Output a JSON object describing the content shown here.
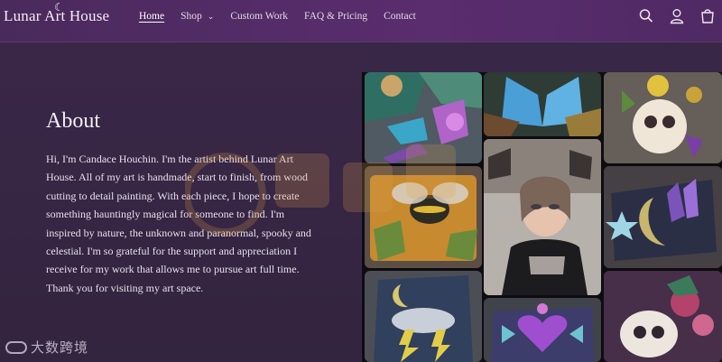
{
  "header": {
    "logo_text": "Lunar Art House",
    "nav": [
      {
        "label": "Home",
        "active": true
      },
      {
        "label": "Shop",
        "has_dropdown": true
      },
      {
        "label": "Custom Work"
      },
      {
        "label": "FAQ & Pricing"
      },
      {
        "label": "Contact"
      }
    ],
    "icons": [
      "search-icon",
      "account-icon",
      "cart-icon"
    ]
  },
  "about": {
    "title": "About",
    "body": "Hi, I'm Candace Houchin. I'm the artist behind Lunar Art House. All of my art is handmade, start to finish, from wood cutting to detail painting. With each piece, I hope to create something hauntingly magical for someone to find. I'm inspired by nature, the unknown and paranormal, spooky and celestial. I'm so grateful for the support and appreciation I receive for my work that allows me to pursue art full time. Thank you for visiting my art space."
  },
  "watermark": {
    "text": "大数跨境"
  },
  "colors": {
    "header_bg": "#55306a",
    "page_bg": "#382746",
    "text": "#e9dfe9",
    "gallery_bg": "#0e0c10"
  }
}
